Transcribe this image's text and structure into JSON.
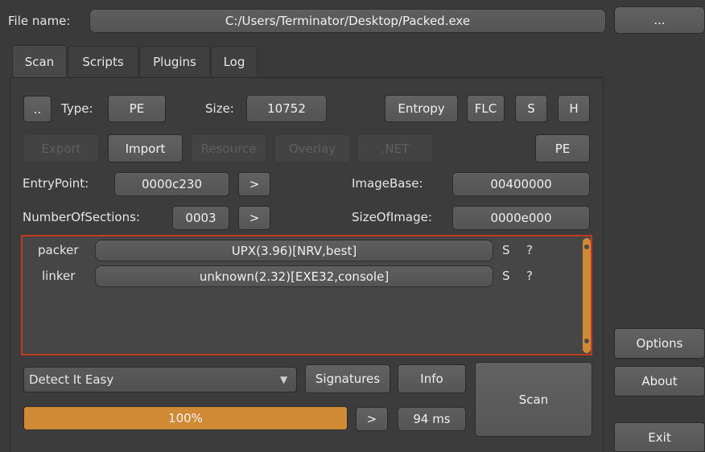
{
  "file": {
    "label": "File name:",
    "path": "C:/Users/Terminator/Desktop/Packed.exe",
    "browse_label": "..."
  },
  "tabs": [
    "Scan",
    "Scripts",
    "Plugins",
    "Log"
  ],
  "row1": {
    "dots": "..",
    "type_label": "Type:",
    "type_value": "PE",
    "size_label": "Size:",
    "size_value": "10752",
    "entropy": "Entropy",
    "flc": "FLC",
    "s": "S",
    "h": "H"
  },
  "row2": {
    "export": "Export",
    "import": "Import",
    "resource": "Resource",
    "overlay": "Overlay",
    "net": ".NET",
    "pe": "PE"
  },
  "entry": {
    "label": "EntryPoint:",
    "value": "0000c230",
    "go": ">"
  },
  "sections": {
    "label": "NumberOfSections:",
    "value": "0003",
    "go": ">"
  },
  "imagebase": {
    "label": "ImageBase:",
    "value": "00400000"
  },
  "sizeofimage": {
    "label": "SizeOfImage:",
    "value": "0000e000"
  },
  "results": [
    {
      "type": "packer",
      "name": "UPX(3.96)[NRV,best]",
      "s": "S",
      "q": "?"
    },
    {
      "type": "linker",
      "name": "unknown(2.32)[EXE32,console]",
      "s": "S",
      "q": "?"
    }
  ],
  "bottom": {
    "engine": "Detect It Easy",
    "signatures": "Signatures",
    "info": "Info",
    "scan": "Scan",
    "progress_text": "100%",
    "progress": 1.0,
    "go": ">",
    "time": "94 ms"
  },
  "side": {
    "options": "Options",
    "about": "About",
    "exit": "Exit"
  },
  "colors": {
    "accent_orange": "#d08a35",
    "frame_red": "#c03a1e"
  }
}
